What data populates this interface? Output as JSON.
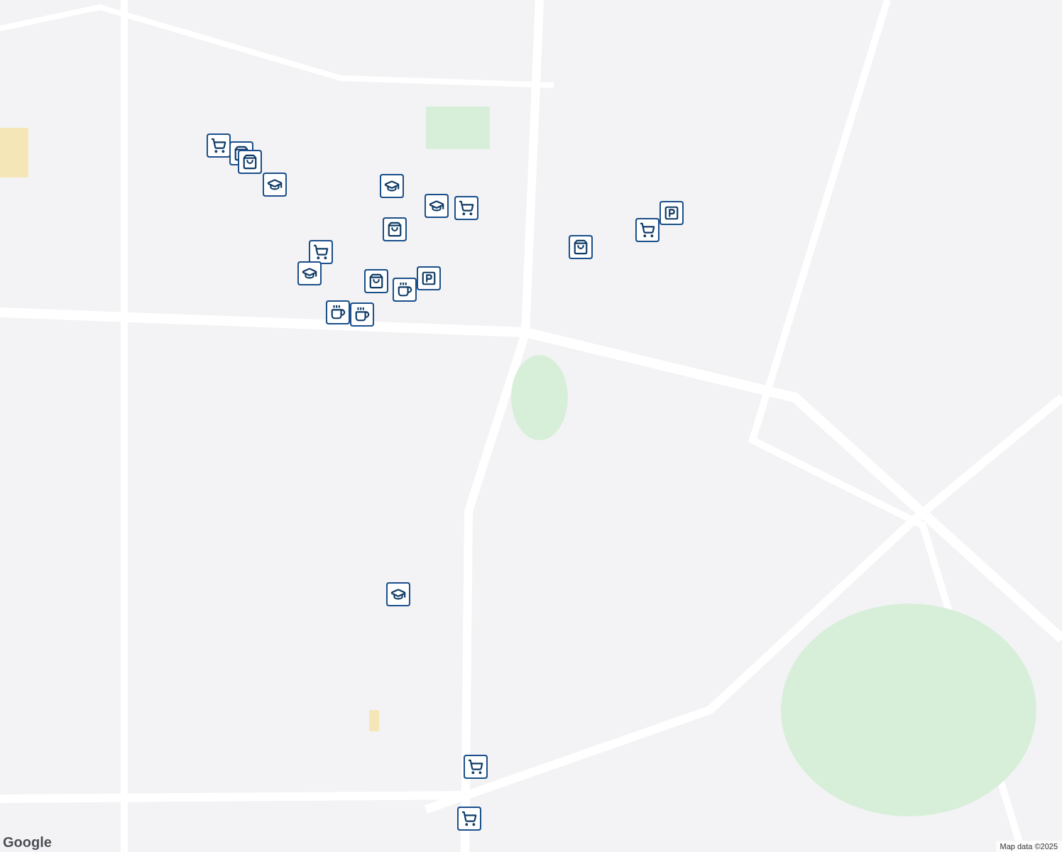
{
  "markers": [
    {
      "kind": "cart"
    },
    {
      "kind": "bag"
    },
    {
      "kind": "bag"
    },
    {
      "kind": "cap"
    },
    {
      "kind": "cap"
    },
    {
      "kind": "cap"
    },
    {
      "kind": "cart"
    },
    {
      "kind": "bag"
    },
    {
      "kind": "cart"
    },
    {
      "kind": "cap"
    },
    {
      "kind": "bag"
    },
    {
      "kind": "parking"
    },
    {
      "kind": "coffee"
    },
    {
      "kind": "coffee"
    },
    {
      "kind": "coffee"
    },
    {
      "kind": "bag"
    },
    {
      "kind": "cart"
    },
    {
      "kind": "parking"
    },
    {
      "kind": "cap"
    },
    {
      "kind": "cart"
    },
    {
      "kind": "cart"
    }
  ],
  "logo": "Google",
  "attribution": "Map data ©2025"
}
